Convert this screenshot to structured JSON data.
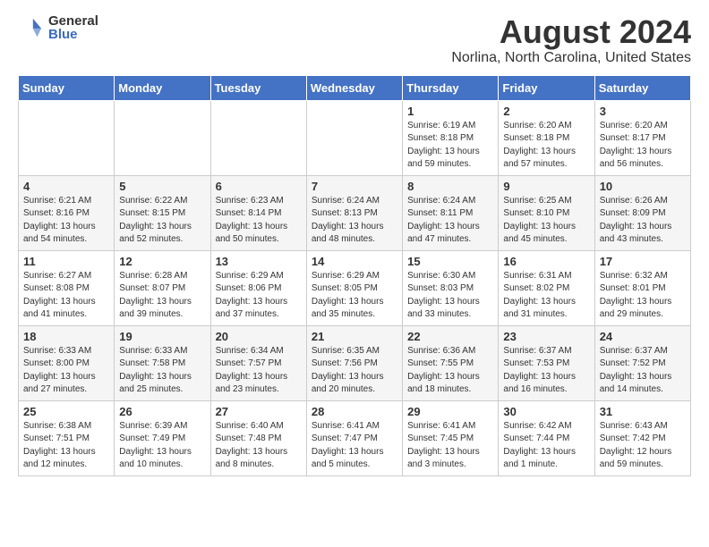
{
  "header": {
    "logo_general": "General",
    "logo_blue": "Blue",
    "main_title": "August 2024",
    "subtitle": "Norlina, North Carolina, United States"
  },
  "calendar": {
    "days_of_week": [
      "Sunday",
      "Monday",
      "Tuesday",
      "Wednesday",
      "Thursday",
      "Friday",
      "Saturday"
    ],
    "weeks": [
      [
        {
          "day": "",
          "info": ""
        },
        {
          "day": "",
          "info": ""
        },
        {
          "day": "",
          "info": ""
        },
        {
          "day": "",
          "info": ""
        },
        {
          "day": "1",
          "info": "Sunrise: 6:19 AM\nSunset: 8:18 PM\nDaylight: 13 hours\nand 59 minutes."
        },
        {
          "day": "2",
          "info": "Sunrise: 6:20 AM\nSunset: 8:18 PM\nDaylight: 13 hours\nand 57 minutes."
        },
        {
          "day": "3",
          "info": "Sunrise: 6:20 AM\nSunset: 8:17 PM\nDaylight: 13 hours\nand 56 minutes."
        }
      ],
      [
        {
          "day": "4",
          "info": "Sunrise: 6:21 AM\nSunset: 8:16 PM\nDaylight: 13 hours\nand 54 minutes."
        },
        {
          "day": "5",
          "info": "Sunrise: 6:22 AM\nSunset: 8:15 PM\nDaylight: 13 hours\nand 52 minutes."
        },
        {
          "day": "6",
          "info": "Sunrise: 6:23 AM\nSunset: 8:14 PM\nDaylight: 13 hours\nand 50 minutes."
        },
        {
          "day": "7",
          "info": "Sunrise: 6:24 AM\nSunset: 8:13 PM\nDaylight: 13 hours\nand 48 minutes."
        },
        {
          "day": "8",
          "info": "Sunrise: 6:24 AM\nSunset: 8:11 PM\nDaylight: 13 hours\nand 47 minutes."
        },
        {
          "day": "9",
          "info": "Sunrise: 6:25 AM\nSunset: 8:10 PM\nDaylight: 13 hours\nand 45 minutes."
        },
        {
          "day": "10",
          "info": "Sunrise: 6:26 AM\nSunset: 8:09 PM\nDaylight: 13 hours\nand 43 minutes."
        }
      ],
      [
        {
          "day": "11",
          "info": "Sunrise: 6:27 AM\nSunset: 8:08 PM\nDaylight: 13 hours\nand 41 minutes."
        },
        {
          "day": "12",
          "info": "Sunrise: 6:28 AM\nSunset: 8:07 PM\nDaylight: 13 hours\nand 39 minutes."
        },
        {
          "day": "13",
          "info": "Sunrise: 6:29 AM\nSunset: 8:06 PM\nDaylight: 13 hours\nand 37 minutes."
        },
        {
          "day": "14",
          "info": "Sunrise: 6:29 AM\nSunset: 8:05 PM\nDaylight: 13 hours\nand 35 minutes."
        },
        {
          "day": "15",
          "info": "Sunrise: 6:30 AM\nSunset: 8:03 PM\nDaylight: 13 hours\nand 33 minutes."
        },
        {
          "day": "16",
          "info": "Sunrise: 6:31 AM\nSunset: 8:02 PM\nDaylight: 13 hours\nand 31 minutes."
        },
        {
          "day": "17",
          "info": "Sunrise: 6:32 AM\nSunset: 8:01 PM\nDaylight: 13 hours\nand 29 minutes."
        }
      ],
      [
        {
          "day": "18",
          "info": "Sunrise: 6:33 AM\nSunset: 8:00 PM\nDaylight: 13 hours\nand 27 minutes."
        },
        {
          "day": "19",
          "info": "Sunrise: 6:33 AM\nSunset: 7:58 PM\nDaylight: 13 hours\nand 25 minutes."
        },
        {
          "day": "20",
          "info": "Sunrise: 6:34 AM\nSunset: 7:57 PM\nDaylight: 13 hours\nand 23 minutes."
        },
        {
          "day": "21",
          "info": "Sunrise: 6:35 AM\nSunset: 7:56 PM\nDaylight: 13 hours\nand 20 minutes."
        },
        {
          "day": "22",
          "info": "Sunrise: 6:36 AM\nSunset: 7:55 PM\nDaylight: 13 hours\nand 18 minutes."
        },
        {
          "day": "23",
          "info": "Sunrise: 6:37 AM\nSunset: 7:53 PM\nDaylight: 13 hours\nand 16 minutes."
        },
        {
          "day": "24",
          "info": "Sunrise: 6:37 AM\nSunset: 7:52 PM\nDaylight: 13 hours\nand 14 minutes."
        }
      ],
      [
        {
          "day": "25",
          "info": "Sunrise: 6:38 AM\nSunset: 7:51 PM\nDaylight: 13 hours\nand 12 minutes."
        },
        {
          "day": "26",
          "info": "Sunrise: 6:39 AM\nSunset: 7:49 PM\nDaylight: 13 hours\nand 10 minutes."
        },
        {
          "day": "27",
          "info": "Sunrise: 6:40 AM\nSunset: 7:48 PM\nDaylight: 13 hours\nand 8 minutes."
        },
        {
          "day": "28",
          "info": "Sunrise: 6:41 AM\nSunset: 7:47 PM\nDaylight: 13 hours\nand 5 minutes."
        },
        {
          "day": "29",
          "info": "Sunrise: 6:41 AM\nSunset: 7:45 PM\nDaylight: 13 hours\nand 3 minutes."
        },
        {
          "day": "30",
          "info": "Sunrise: 6:42 AM\nSunset: 7:44 PM\nDaylight: 13 hours\nand 1 minute."
        },
        {
          "day": "31",
          "info": "Sunrise: 6:43 AM\nSunset: 7:42 PM\nDaylight: 12 hours\nand 59 minutes."
        }
      ]
    ]
  }
}
